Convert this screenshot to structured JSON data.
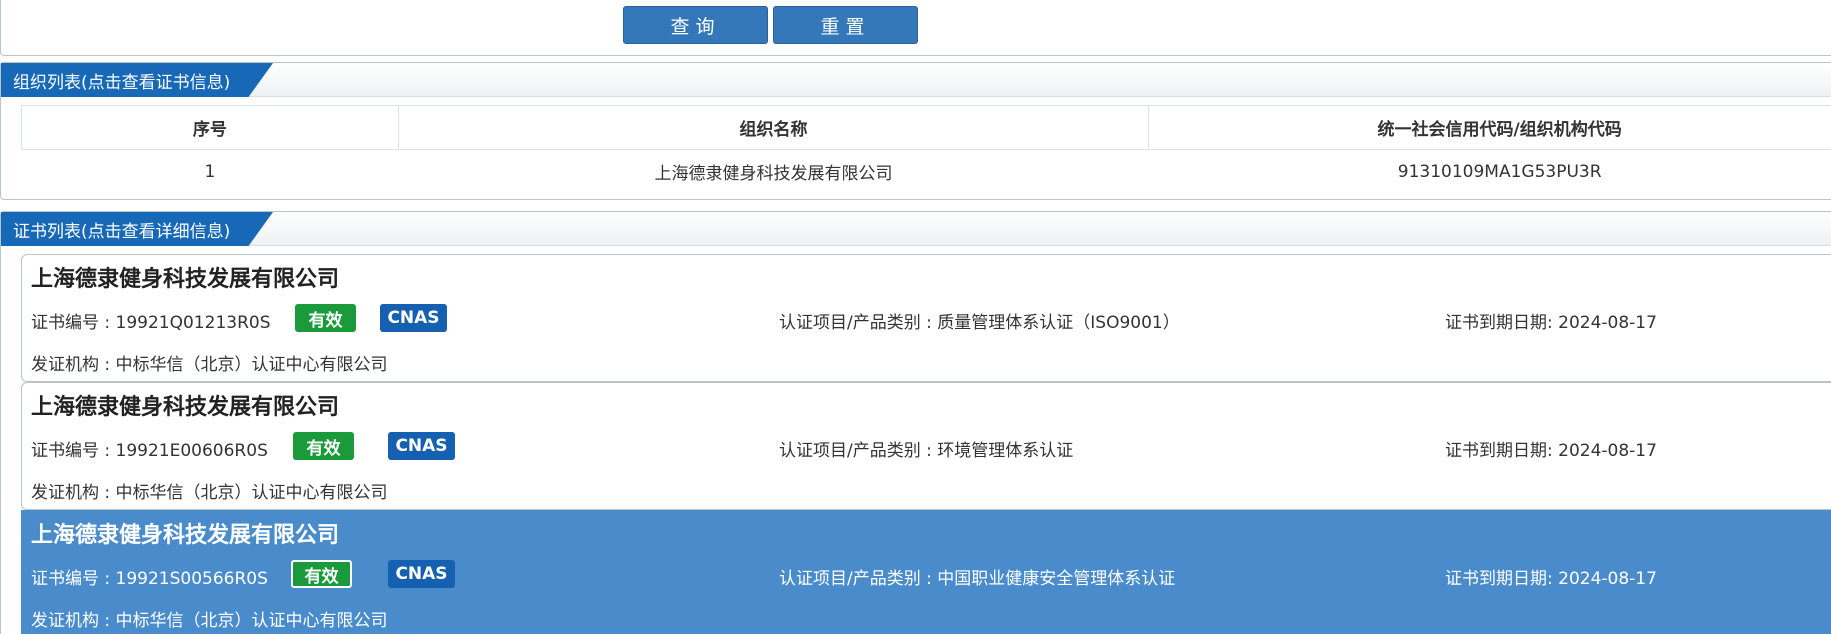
{
  "query": {
    "query_label": "查询",
    "reset_label": "重置"
  },
  "org_section": {
    "title": "组织列表(点击查看证书信息)",
    "columns": [
      "序号",
      "组织名称",
      "统一社会信用代码/组织机构代码"
    ],
    "rows": [
      {
        "index": "1",
        "name": "上海德隶健身科技发展有限公司",
        "code": "91310109MA1G53PU3R"
      }
    ]
  },
  "cert_section": {
    "title": "证书列表(点击查看详细信息)",
    "certs": [
      {
        "org_name": "上海德隶健身科技发展有限公司",
        "cert_no": "证书编号 : 19921Q01213R0S",
        "status": "有效",
        "accreditation": "CNAS",
        "item": "认证项目/产品类别 : 质量管理体系认证（ISO9001）",
        "expiry": "证书到期日期: 2024-08-17",
        "issuer": "发证机构 : 中标华信（北京）认证中心有限公司"
      },
      {
        "org_name": "上海德隶健身科技发展有限公司",
        "cert_no": "证书编号 : 19921E00606R0S",
        "status": "有效",
        "accreditation": "CNAS",
        "item": "认证项目/产品类别 : 环境管理体系认证",
        "expiry": "证书到期日期: 2024-08-17",
        "issuer": "发证机构 : 中标华信（北京）认证中心有限公司"
      },
      {
        "org_name": "上海德隶健身科技发展有限公司",
        "cert_no": "证书编号 : 19921S00566R0S",
        "status": "有效",
        "accreditation": "CNAS",
        "item": "认证项目/产品类别 : 中国职业健康安全管理体系认证",
        "expiry": "证书到期日期: 2024-08-17",
        "issuer": "发证机构 : 中标华信（北京）认证中心有限公司"
      }
    ]
  },
  "colors": {
    "primary": "#3578b9",
    "header_tab": "#1769b8",
    "selected_row": "#4a8ccb",
    "valid": "#1a9a3b",
    "cnas": "#1560b0"
  }
}
